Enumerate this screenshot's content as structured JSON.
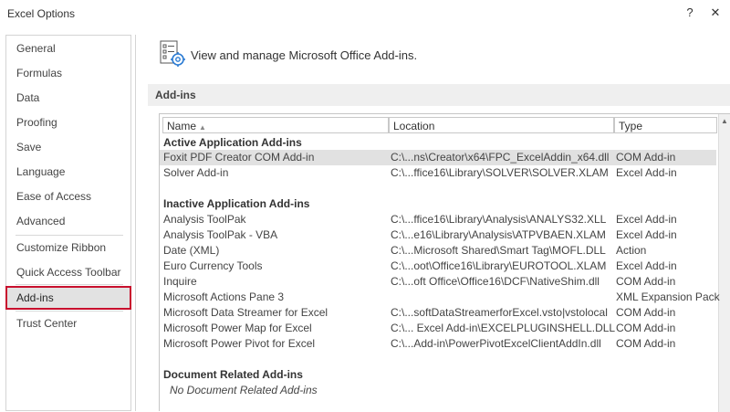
{
  "window": {
    "title": "Excel Options",
    "help": "?",
    "close": "✕"
  },
  "sidebar": {
    "items": [
      {
        "label": "General"
      },
      {
        "label": "Formulas"
      },
      {
        "label": "Data"
      },
      {
        "label": "Proofing"
      },
      {
        "label": "Save"
      },
      {
        "label": "Language"
      },
      {
        "label": "Ease of Access"
      },
      {
        "label": "Advanced"
      },
      {
        "label": "Customize Ribbon"
      },
      {
        "label": "Quick Access Toolbar"
      },
      {
        "label": "Add-ins",
        "selected": true
      },
      {
        "label": "Trust Center"
      }
    ]
  },
  "header": {
    "text": "View and manage Microsoft Office Add-ins.",
    "icon": "addins-gear-icon"
  },
  "section": {
    "title": "Add-ins"
  },
  "grid": {
    "columns": [
      "Name",
      "Location",
      "Type"
    ],
    "sort_indicator": "▲",
    "active": {
      "title": "Active Application Add-ins",
      "rows": [
        {
          "name": "Foxit PDF Creator COM Add-in",
          "location": "C:\\...ns\\Creator\\x64\\FPC_ExcelAddin_x64.dll",
          "type": "COM Add-in"
        },
        {
          "name": "Solver Add-in",
          "location": "C:\\...ffice16\\Library\\SOLVER\\SOLVER.XLAM",
          "type": "Excel Add-in"
        }
      ]
    },
    "inactive": {
      "title": "Inactive Application Add-ins",
      "rows": [
        {
          "name": "Analysis ToolPak",
          "location": "C:\\...ffice16\\Library\\Analysis\\ANALYS32.XLL",
          "type": "Excel Add-in"
        },
        {
          "name": "Analysis ToolPak - VBA",
          "location": "C:\\...e16\\Library\\Analysis\\ATPVBAEN.XLAM",
          "type": "Excel Add-in"
        },
        {
          "name": "Date (XML)",
          "location": "C:\\...Microsoft Shared\\Smart Tag\\MOFL.DLL",
          "type": "Action"
        },
        {
          "name": "Euro Currency Tools",
          "location": "C:\\...oot\\Office16\\Library\\EUROTOOL.XLAM",
          "type": "Excel Add-in"
        },
        {
          "name": "Inquire",
          "location": "C:\\...oft Office\\Office16\\DCF\\NativeShim.dll",
          "type": "COM Add-in"
        },
        {
          "name": "Microsoft Actions Pane 3",
          "location": "",
          "type": "XML Expansion Pack"
        },
        {
          "name": "Microsoft Data Streamer for Excel",
          "location": "C:\\...softDataStreamerforExcel.vsto|vstolocal",
          "type": "COM Add-in"
        },
        {
          "name": "Microsoft Power Map for Excel",
          "location": "C:\\... Excel Add-in\\EXCELPLUGINSHELL.DLL",
          "type": "COM Add-in"
        },
        {
          "name": "Microsoft Power Pivot for Excel",
          "location": "C:\\...Add-in\\PowerPivotExcelClientAddIn.dll",
          "type": "COM Add-in"
        }
      ]
    },
    "document": {
      "title": "Document Related Add-ins",
      "empty_text": "No Document Related Add-ins"
    }
  },
  "colors": {
    "selected_outline": "#c8102e",
    "selected_bg": "#e2e2e2",
    "row_highlight": "#e1e1e1",
    "section_bg": "#efefef"
  }
}
